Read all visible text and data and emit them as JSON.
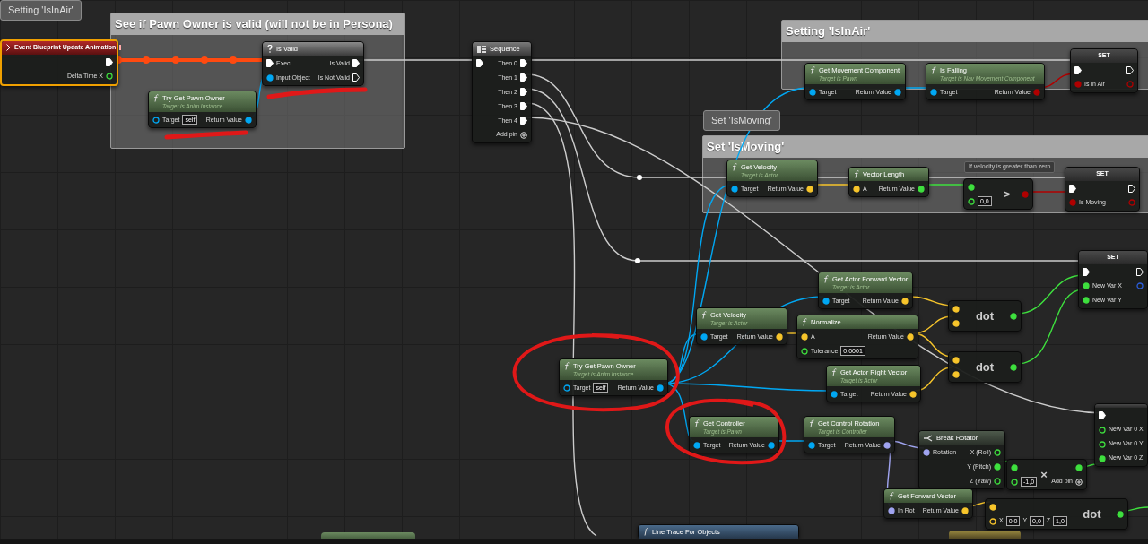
{
  "comments": [
    {
      "title": "See if Pawn Owner is valid (will not be in Persona)"
    },
    {
      "title": "Setting 'IsInAir'",
      "bubble": "Setting 'IsInAir'"
    },
    {
      "title": "Set 'IsMoving'",
      "bubble": "Set 'IsMoving'"
    }
  ],
  "nodes": [
    {
      "kind": "event",
      "title": "Event Blueprint Update Animation",
      "selected": true,
      "outputs": [
        {
          "kind": "exec",
          "connected": true
        },
        {
          "label": "Delta Time X",
          "kind": "float",
          "connected": false
        }
      ]
    },
    {
      "kind": "macro",
      "title": "Is Valid",
      "selected": false,
      "inputs": [
        {
          "label": "Exec",
          "kind": "exec",
          "connected": true
        },
        {
          "label": "Input Object",
          "kind": "object",
          "connected": true
        }
      ],
      "outputs": [
        {
          "label": "Is Valid",
          "kind": "exec",
          "connected": true
        },
        {
          "label": "Is Not Valid",
          "kind": "exec",
          "connected": false
        }
      ]
    },
    {
      "kind": "function",
      "title": "Try Get Pawn Owner",
      "subtitle": "Target is Anim Instance",
      "selected": false,
      "inputs": [
        {
          "label": "Target",
          "kind": "object",
          "connected": false,
          "value": "self"
        }
      ],
      "outputs": [
        {
          "label": "Return Value",
          "kind": "object",
          "connected": true
        }
      ]
    },
    {
      "kind": "sequence",
      "title": "Sequence",
      "selected": false,
      "add_pin": "Add pin",
      "inputs": [
        {
          "kind": "exec",
          "connected": true
        }
      ],
      "outputs": [
        {
          "label": "Then 0",
          "kind": "exec",
          "connected": true
        },
        {
          "label": "Then 1",
          "kind": "exec",
          "connected": true
        },
        {
          "label": "Then 2",
          "kind": "exec",
          "connected": true
        },
        {
          "label": "Then 3",
          "kind": "exec",
          "connected": true
        },
        {
          "label": "Then 4",
          "kind": "exec",
          "connected": true
        }
      ]
    },
    {
      "kind": "function",
      "title": "Get Movement Component",
      "subtitle": "Target is Pawn",
      "selected": false,
      "inputs": [
        {
          "label": "Target",
          "kind": "object",
          "connected": true
        }
      ],
      "outputs": [
        {
          "label": "Return Value",
          "kind": "object",
          "connected": true
        }
      ]
    },
    {
      "kind": "function",
      "title": "Is Falling",
      "subtitle": "Target is Nav Movement Component",
      "selected": false,
      "inputs": [
        {
          "label": "Target",
          "kind": "object",
          "connected": true
        }
      ],
      "outputs": [
        {
          "label": "Return Value",
          "kind": "bool",
          "connected": true
        }
      ]
    },
    {
      "kind": "set",
      "title": "SET",
      "selected": false,
      "inputs": [
        {
          "kind": "exec",
          "connected": true
        },
        {
          "label": "Is in Air",
          "kind": "bool",
          "connected": true
        }
      ],
      "outputs": [
        {
          "kind": "exec",
          "connected": false
        },
        {
          "kind": "bool",
          "connected": false
        }
      ]
    },
    {
      "kind": "function",
      "title": "Get Velocity",
      "subtitle": "Target is Actor",
      "selected": false,
      "inputs": [
        {
          "label": "Target",
          "kind": "object",
          "connected": true
        }
      ],
      "outputs": [
        {
          "label": "Return Value",
          "kind": "vector",
          "connected": true
        }
      ]
    },
    {
      "kind": "function",
      "title": "Vector Length",
      "selected": false,
      "inputs": [
        {
          "label": "A",
          "kind": "vector",
          "connected": true
        }
      ],
      "outputs": [
        {
          "label": "Return Value",
          "kind": "float",
          "connected": true
        }
      ]
    },
    {
      "kind": "operator",
      "title": ">",
      "comment": "If velocity is greater than zero",
      "selected": false,
      "inputs": [
        {
          "kind": "float",
          "connected": true
        },
        {
          "kind": "float",
          "connected": false,
          "value": "0,0"
        }
      ],
      "outputs": [
        {
          "kind": "bool",
          "connected": true
        }
      ]
    },
    {
      "kind": "set",
      "title": "SET",
      "selected": false,
      "inputs": [
        {
          "kind": "exec",
          "connected": true
        },
        {
          "label": "Is Moving",
          "kind": "bool",
          "connected": true
        }
      ],
      "outputs": [
        {
          "kind": "exec",
          "connected": false
        },
        {
          "kind": "bool",
          "connected": false
        }
      ]
    },
    {
      "kind": "function",
      "title": "Get Actor Forward Vector",
      "subtitle": "Target is Actor",
      "selected": false,
      "inputs": [
        {
          "label": "Target",
          "kind": "object",
          "connected": true
        }
      ],
      "outputs": [
        {
          "label": "Return Value",
          "kind": "vector",
          "connected": true
        }
      ]
    },
    {
      "kind": "set",
      "title": "SET",
      "selected": false,
      "inputs": [
        {
          "kind": "exec",
          "connected": true
        },
        {
          "label": "New Var X",
          "kind": "float",
          "connected": true
        },
        {
          "label": "New Var Y",
          "kind": "float",
          "connected": true
        }
      ],
      "outputs": [
        {
          "kind": "exec",
          "connected": false
        },
        {
          "kind": "struct",
          "connected": false
        }
      ]
    },
    {
      "kind": "function",
      "title": "Get Velocity",
      "subtitle": "Target is Actor",
      "selected": false,
      "inputs": [
        {
          "label": "Target",
          "kind": "object",
          "connected": true
        }
      ],
      "outputs": [
        {
          "label": "Return Value",
          "kind": "vector",
          "connected": true
        }
      ]
    },
    {
      "kind": "function",
      "title": "Normalize",
      "selected": false,
      "inputs": [
        {
          "label": "A",
          "kind": "vector",
          "connected": true
        },
        {
          "label": "Tolerance",
          "kind": "float",
          "connected": false,
          "value": "0,0001"
        }
      ],
      "outputs": [
        {
          "label": "Return Value",
          "kind": "vector",
          "connected": true
        }
      ]
    },
    {
      "kind": "operator",
      "title": "dot",
      "selected": false,
      "inputs": [
        {
          "kind": "vector",
          "connected": true
        },
        {
          "kind": "vector",
          "connected": true
        }
      ],
      "outputs": [
        {
          "kind": "float",
          "connected": true
        }
      ]
    },
    {
      "kind": "operator",
      "title": "dot",
      "selected": false,
      "inputs": [
        {
          "kind": "vector",
          "connected": true
        },
        {
          "kind": "vector",
          "connected": true
        }
      ],
      "outputs": [
        {
          "kind": "float",
          "connected": true
        }
      ]
    },
    {
      "kind": "function",
      "title": "Get Actor Right Vector",
      "subtitle": "Target is Actor",
      "selected": false,
      "inputs": [
        {
          "label": "Target",
          "kind": "object",
          "connected": true
        }
      ],
      "outputs": [
        {
          "label": "Return Value",
          "kind": "vector",
          "connected": true
        }
      ]
    },
    {
      "kind": "function",
      "title": "Try Get Pawn Owner",
      "subtitle": "Target is Anim Instance",
      "selected": false,
      "inputs": [
        {
          "label": "Target",
          "kind": "object",
          "connected": false,
          "value": "self"
        }
      ],
      "outputs": [
        {
          "label": "Return Value",
          "kind": "object",
          "connected": true
        }
      ]
    },
    {
      "kind": "function",
      "title": "Get Controller",
      "subtitle": "Target is Pawn",
      "selected": false,
      "inputs": [
        {
          "label": "Target",
          "kind": "object",
          "connected": true
        }
      ],
      "outputs": [
        {
          "label": "Return Value",
          "kind": "object",
          "connected": true
        }
      ]
    },
    {
      "kind": "function",
      "title": "Get Control Rotation",
      "subtitle": "Target is Controller",
      "selected": false,
      "inputs": [
        {
          "label": "Target",
          "kind": "object",
          "connected": true
        }
      ],
      "outputs": [
        {
          "label": "Return Value",
          "kind": "rotator",
          "connected": true
        }
      ]
    },
    {
      "kind": "break",
      "title": "Break Rotator",
      "selected": false,
      "inputs": [
        {
          "label": "Rotation",
          "kind": "rotator",
          "connected": true
        }
      ],
      "outputs": [
        {
          "label": "X (Roll)",
          "kind": "float",
          "connected": false
        },
        {
          "label": "Y (Pitch)",
          "kind": "float",
          "connected": true
        },
        {
          "label": "Z (Yaw)",
          "kind": "float",
          "connected": false
        }
      ]
    },
    {
      "kind": "operator",
      "title": "×",
      "add_pin": "Add pin",
      "selected": false,
      "inputs": [
        {
          "kind": "float",
          "connected": true
        },
        {
          "kind": "float",
          "connected": false,
          "value": "-1,0"
        }
      ],
      "outputs": [
        {
          "kind": "float",
          "connected": true
        }
      ]
    },
    {
      "kind": "function",
      "title": "Get Forward Vector",
      "selected": false,
      "inputs": [
        {
          "label": "In Rot",
          "kind": "rotator",
          "connected": true
        }
      ],
      "outputs": [
        {
          "label": "Return Value",
          "kind": "vector",
          "connected": true
        }
      ]
    },
    {
      "kind": "operator",
      "title": "dot",
      "selected": false,
      "inputs": [
        {
          "kind": "vector",
          "connected": true
        },
        {
          "kind": "vector",
          "connected": false,
          "fields": [
            {
              "label": "X",
              "value": "0,0"
            },
            {
              "label": "Y",
              "value": "0,0"
            },
            {
              "label": "Z",
              "value": "1,0"
            }
          ]
        }
      ],
      "outputs": [
        {
          "kind": "float",
          "connected": true
        }
      ]
    },
    {
      "kind": "set",
      "selected": false,
      "inputs": [
        {
          "kind": "exec",
          "connected": true
        },
        {
          "label": "New Var 0 X",
          "kind": "float",
          "connected": false
        },
        {
          "label": "New Var 0 Y",
          "kind": "float",
          "connected": false
        },
        {
          "label": "New Var 0 Z",
          "kind": "float",
          "connected": true
        }
      ]
    },
    {
      "kind": "callable",
      "title": "Line Trace For Objects",
      "selected": false
    }
  ]
}
